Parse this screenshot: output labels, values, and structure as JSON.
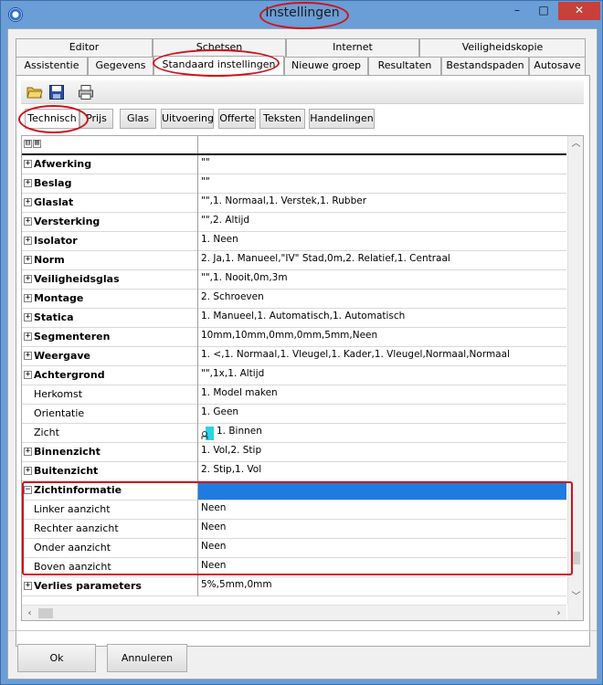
{
  "window": {
    "title": "Instellingen",
    "minimize_glyph": "–",
    "maximize_glyph": "□",
    "close_glyph": "✕"
  },
  "tabs": {
    "row1": [
      "Editor",
      "Schetsen",
      "Internet",
      "Veiligheidskopie"
    ],
    "row2": [
      "Assistentie",
      "Gegevens",
      "Standaard instellingen",
      "Nieuwe groep",
      "Resultaten",
      "Bestandspaden",
      "Autosave"
    ],
    "active": "Standaard instellingen"
  },
  "toolbar": {
    "icons": [
      "open-folder-icon",
      "save-disk-icon",
      "print-icon"
    ]
  },
  "subtabs": {
    "items": [
      "Technisch",
      "Prijs",
      "Glas",
      "Uitvoering",
      "Offerte",
      "Teksten",
      "Handelingen"
    ],
    "active": "Technisch"
  },
  "grid": {
    "header_expand_all": "⊟",
    "header_collapse_all": "⊞",
    "rows": [
      {
        "name": "Afwerking",
        "value": "\"\"",
        "bold": true,
        "exp": "+"
      },
      {
        "name": "Beslag",
        "value": "\"\"",
        "bold": true,
        "exp": "+"
      },
      {
        "name": "Glaslat",
        "value": "\"\",1. Normaal,1. Verstek,1. Rubber",
        "bold": true,
        "exp": "+"
      },
      {
        "name": "Versterking",
        "value": "\"\",2. Altijd",
        "bold": true,
        "exp": "+"
      },
      {
        "name": "Isolator",
        "value": "1. Neen",
        "bold": true,
        "exp": "+"
      },
      {
        "name": "Norm",
        "value": "2. Ja,1. Manueel,\"IV\" Stad,0m,2. Relatief,1. Centraal",
        "bold": true,
        "exp": "+"
      },
      {
        "name": "Veiligheidsglas",
        "value": "\"\",1. Nooit,0m,3m",
        "bold": true,
        "exp": "+"
      },
      {
        "name": "Montage",
        "value": "2. Schroeven",
        "bold": true,
        "exp": "+"
      },
      {
        "name": "Statica",
        "value": "1. Manueel,1. Automatisch,1. Automatisch",
        "bold": true,
        "exp": "+"
      },
      {
        "name": "Segmenteren",
        "value": "10mm,10mm,0mm,0mm,5mm,Neen",
        "bold": true,
        "exp": "+"
      },
      {
        "name": "Weergave",
        "value": "1. <,1. Normaal,1. Vleugel,1. Kader,1. Vleugel,Normaal,Normaal",
        "bold": true,
        "exp": "+"
      },
      {
        "name": "Achtergrond",
        "value": "\"\",1x,1. Altijd",
        "bold": true,
        "exp": "+"
      },
      {
        "name": "Herkomst",
        "value": "1. Model maken",
        "bold": false,
        "exp": ""
      },
      {
        "name": "Orientatie",
        "value": "1. Geen",
        "bold": false,
        "exp": ""
      },
      {
        "name": "Zicht",
        "value": "1. Binnen",
        "bold": false,
        "exp": "",
        "swatch": true
      },
      {
        "name": "Binnenzicht",
        "value": "1. Vol,2. Stip",
        "bold": true,
        "exp": "+"
      },
      {
        "name": "Buitenzicht",
        "value": "2. Stip,1. Vol",
        "bold": true,
        "exp": "+"
      },
      {
        "name": "Zichtinformatie",
        "value": "",
        "bold": true,
        "exp": "−",
        "selected": true
      },
      {
        "name": "Linker aanzicht",
        "value": "Neen",
        "bold": false,
        "exp": "",
        "child": true
      },
      {
        "name": "Rechter aanzicht",
        "value": "Neen",
        "bold": false,
        "exp": "",
        "child": true
      },
      {
        "name": "Onder aanzicht",
        "value": "Neen",
        "bold": false,
        "exp": "",
        "child": true
      },
      {
        "name": "Boven aanzicht",
        "value": "Neen",
        "bold": false,
        "exp": "",
        "child": true
      },
      {
        "name": "Verlies parameters",
        "value": "5%,5mm,0mm",
        "bold": true,
        "exp": "+"
      }
    ]
  },
  "buttons": {
    "ok": "Ok",
    "cancel": "Annuleren"
  },
  "colors": {
    "selection": "#1e7be0",
    "annotation": "#d0111a",
    "swatch": "#2ad4e8"
  }
}
